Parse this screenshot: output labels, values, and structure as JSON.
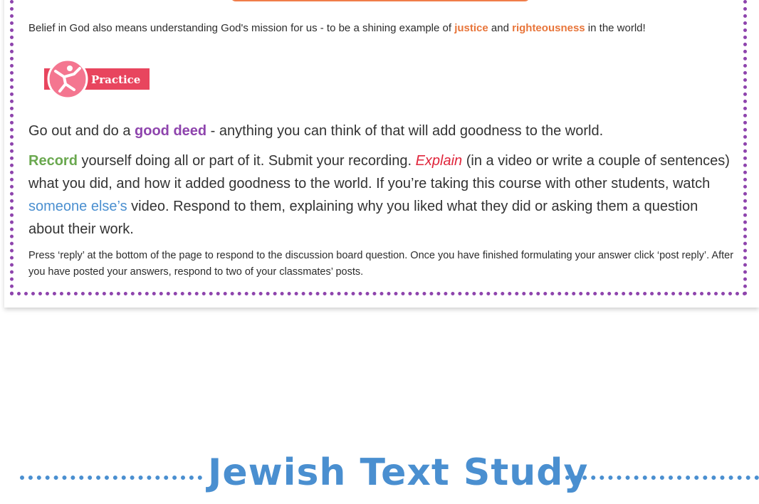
{
  "belief": {
    "pre": "Belief in God also means understanding God's mission for us - to be a shining example of ",
    "justice": "justice",
    "and": " and ",
    "righteousness": "righteousness",
    "post": " in the world!"
  },
  "practice_badge": {
    "label": "Practice",
    "icon": "person-stretching-icon",
    "accent": "#ef5b7a"
  },
  "p1": {
    "pre": "Go out and do a ",
    "good_deed": "good deed",
    "post": " - anything you can think of that will add goodness to the world."
  },
  "p2": {
    "record": "Record",
    "a": " yourself doing all or part of it. Submit your recording. ",
    "explain": "Explain",
    "b": " (in a video or write a couple of sentences) what you did, and how it added goodness to the world. If you’re taking this course with other students, watch ",
    "someone": "someone else’s",
    "c": " video. Respond to them, explaining why you liked what they did or asking them a question about their work."
  },
  "instructions": "Press ‘reply’ at the bottom of the page to respond to the discussion board question. Once you have finished formulating your answer click ‘post reply’. After you have posted your answers, respond to two of your classmates’ posts.",
  "section_heading": "Jewish Text Study",
  "colors": {
    "purple": "#8e44ad",
    "orange": "#e8753a",
    "blue": "#4a8fd0",
    "green": "#6aa84f",
    "red": "#e0263c"
  }
}
